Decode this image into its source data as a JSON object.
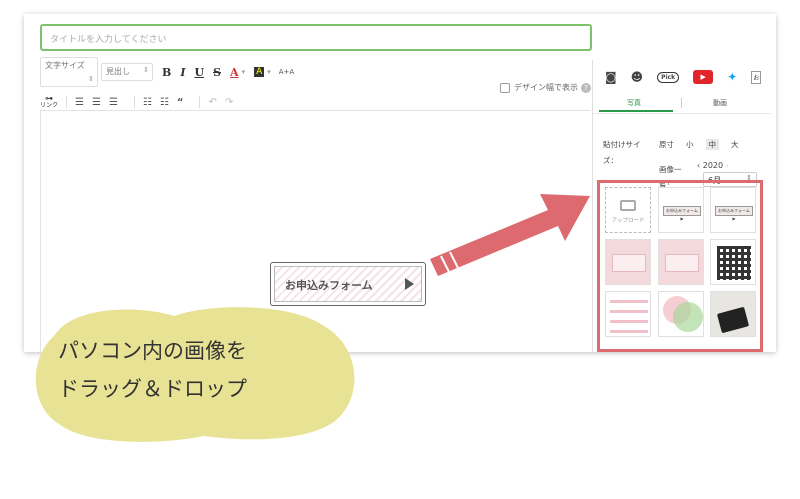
{
  "editor": {
    "title_placeholder": "タイトルを入力してください",
    "toolbar": {
      "font_size_label": "文字サイズ",
      "heading_label": "見出し",
      "bold": "B",
      "italic": "I",
      "underline": "U",
      "strike": "S",
      "text_color": "A",
      "highlight": "A",
      "resize": "A+A",
      "link_label": "リンク",
      "quote": "“"
    },
    "design_width_label": "デザイン幅で表示",
    "help": "?"
  },
  "panel": {
    "pick_label": "Pick",
    "tabs": [
      "写真",
      "動画"
    ],
    "paste_size_label": "貼付けサイズ：",
    "sizes": [
      "原寸",
      "小",
      "中",
      "大"
    ],
    "image_list_label": "画像一覧：",
    "year": "2020",
    "month": "6月",
    "upload_label": "アップロード",
    "thumb_button_label": "お申込みフォーム ▶"
  },
  "overlay": {
    "stamp_label": "お申込みフォーム",
    "bubble_lines": [
      "パソコン内の画像を",
      "ドラッグ＆ドロップ"
    ]
  },
  "colors": {
    "accent_green": "#7dc26b",
    "highlight_red": "#dc6a6e",
    "bubble_yellow": "#e8e394"
  }
}
